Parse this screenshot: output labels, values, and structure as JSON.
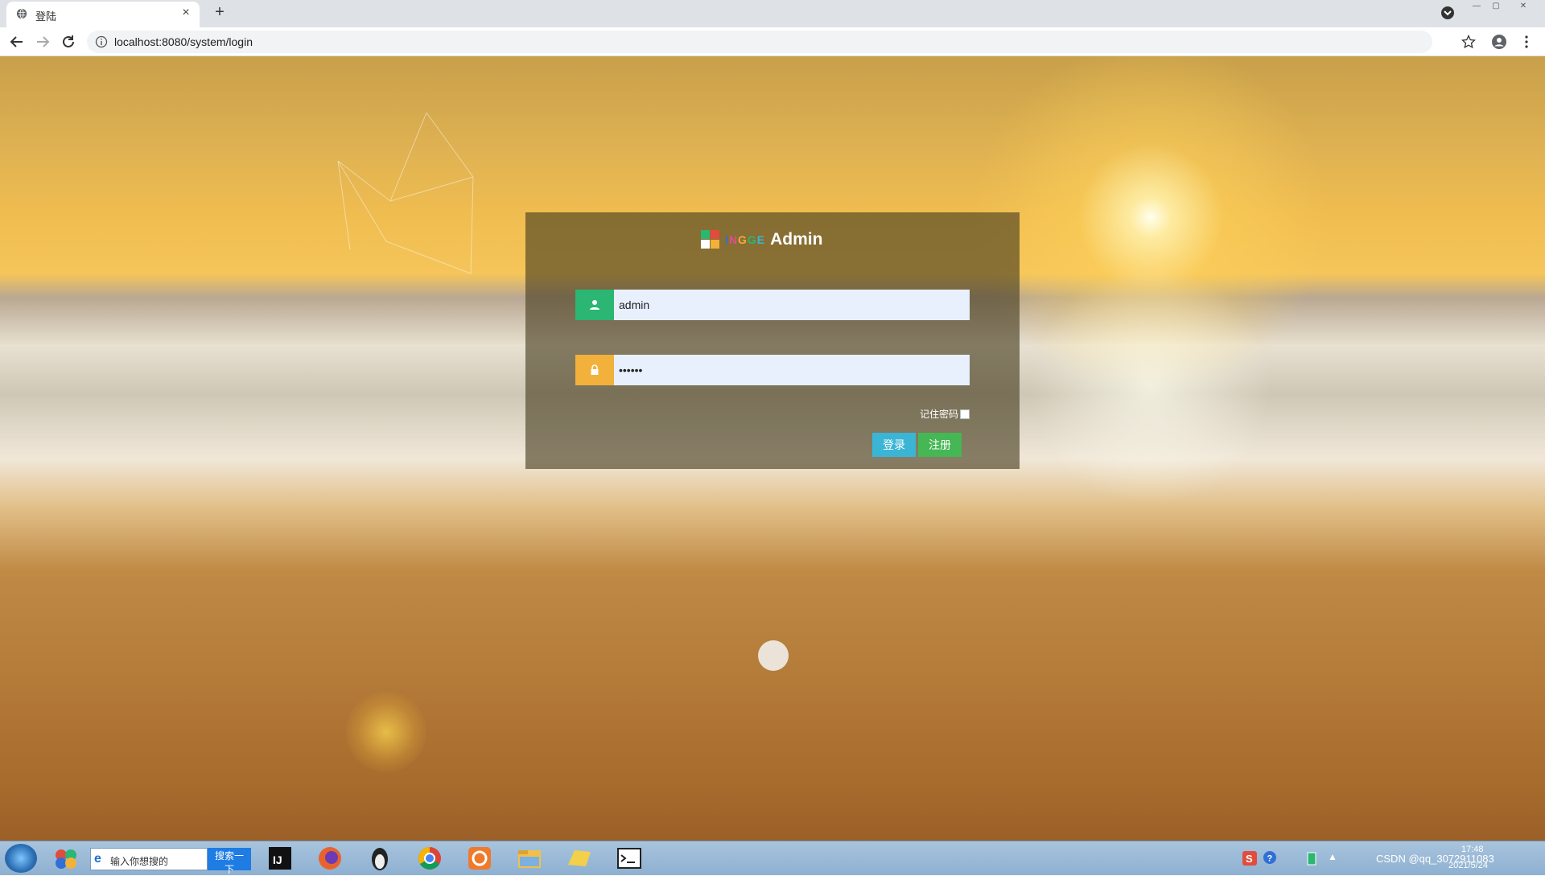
{
  "browser": {
    "tab_title": "登陆",
    "tab_close": "×",
    "new_tab": "+",
    "url": "localhost:8080/system/login",
    "window_controls": {
      "minimize": "—",
      "maximize": "▢",
      "close": "✕"
    }
  },
  "login": {
    "logo_letters": [
      "I",
      "N",
      "G",
      "G",
      "E"
    ],
    "logo_letter_colors": [
      "#2f6fd6",
      "#e24c8a",
      "#f2a93b",
      "#2bb673",
      "#3bb5d6"
    ],
    "logo_mark_colors": [
      "#2bb673",
      "#e24c3c",
      "#ffffff",
      "#f2b13a"
    ],
    "logo_word": "Admin",
    "username_value": "admin",
    "password_value": "••••••",
    "remember_label": "记住密码",
    "login_button": "登录",
    "register_button": "注册",
    "user_icon_color": "#2bb673",
    "lock_icon_color": "#f2b13a"
  },
  "taskbar": {
    "search_placeholder": "输入你想搜的",
    "search_button": "搜索一下",
    "apps": [
      "colorball-icon",
      "intellij-icon",
      "firefox-icon",
      "penguin-icon",
      "chrome-icon",
      "gear-app-icon",
      "file-explorer-icon",
      "folder-icon",
      "terminal-icon"
    ],
    "tray_text": "CSDN @qq_3072911083",
    "clock_time": "17:48",
    "clock_date": "2021/5/24"
  }
}
